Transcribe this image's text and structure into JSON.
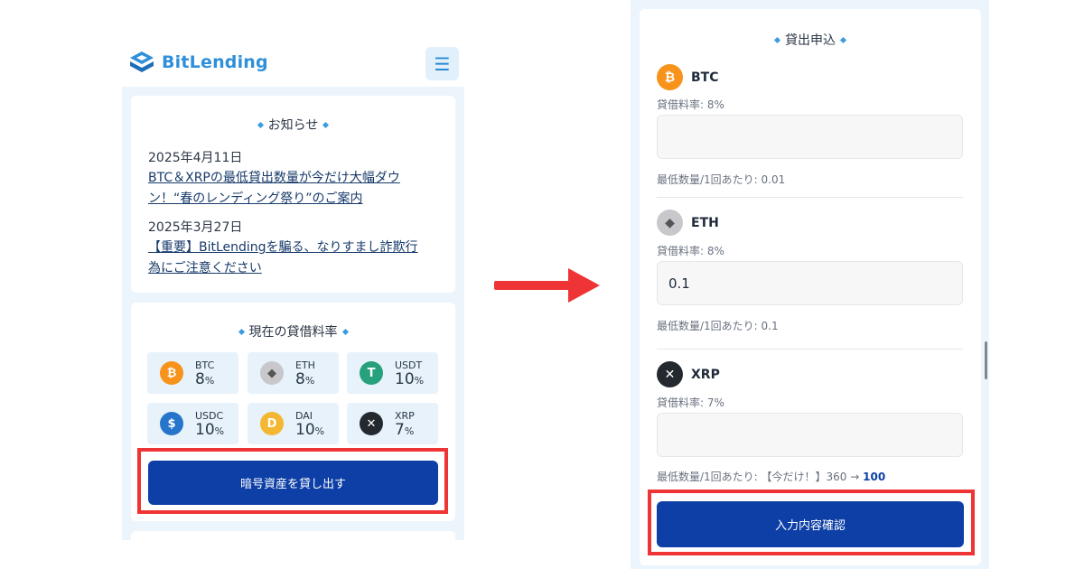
{
  "left": {
    "brand": "BitLending",
    "menu_icon": "☰",
    "notice": {
      "title": "お知らせ",
      "items": [
        {
          "date": "2025年4月11日",
          "line1": "BTC＆XRPの最低貸出数量が今だけ大幅ダウ",
          "line2": "ン！“春のレンディング祭り”のご案内"
        },
        {
          "date": "2025年3月27日",
          "line1": "【重要】BitLendingを騙る、なりすまし詐欺行",
          "line2": "為にご注意ください"
        }
      ]
    },
    "rates": {
      "title": "現在の貸借料率",
      "tiles": [
        {
          "symbol": "BTC",
          "value": "8",
          "unit": "%",
          "icon": "bitcoin-icon",
          "color": "#f7931a",
          "glyph": "₿"
        },
        {
          "symbol": "ETH",
          "value": "8",
          "unit": "%",
          "icon": "ethereum-icon",
          "color": "#c8c8cc",
          "glyph": "◆"
        },
        {
          "symbol": "USDT",
          "value": "10",
          "unit": "%",
          "icon": "tether-icon",
          "color": "#26a17b",
          "glyph": "T"
        },
        {
          "symbol": "USDC",
          "value": "10",
          "unit": "%",
          "icon": "usdc-icon",
          "color": "#2775ca",
          "glyph": "$"
        },
        {
          "symbol": "DAI",
          "value": "10",
          "unit": "%",
          "icon": "dai-icon",
          "color": "#f4b731",
          "glyph": "D"
        },
        {
          "symbol": "XRP",
          "value": "7",
          "unit": "%",
          "icon": "xrp-icon",
          "color": "#23292f",
          "glyph": "✕"
        }
      ]
    },
    "lend_button": "暗号資産を貸し出す"
  },
  "right": {
    "title": "貸出申込",
    "coins": [
      {
        "name": "BTC",
        "rate": "貸借料率: 8%",
        "value": "",
        "min": "最低数量/1回あたり: 0.01",
        "icon": "bitcoin-icon",
        "color": "#f7931a",
        "glyph": "₿"
      },
      {
        "name": "ETH",
        "rate": "貸借料率: 8%",
        "value": "0.1",
        "min": "最低数量/1回あたり: 0.1",
        "icon": "ethereum-icon",
        "color": "#c8c8cc",
        "glyph": "◆"
      },
      {
        "name": "XRP",
        "rate": "貸借料率: 7%",
        "value": "",
        "min_prefix": "最低数量/1回あたり: 【今だけ！】360 → ",
        "min_highlight": "100",
        "icon": "xrp-icon",
        "color": "#23292f",
        "glyph": "✕"
      }
    ],
    "confirm_button": "入力内容確認"
  },
  "colors": {
    "highlight_box": "#ee3434",
    "primary": "#0d3fa6",
    "brand": "#2f8fd8",
    "arrow": "#ee3434"
  }
}
